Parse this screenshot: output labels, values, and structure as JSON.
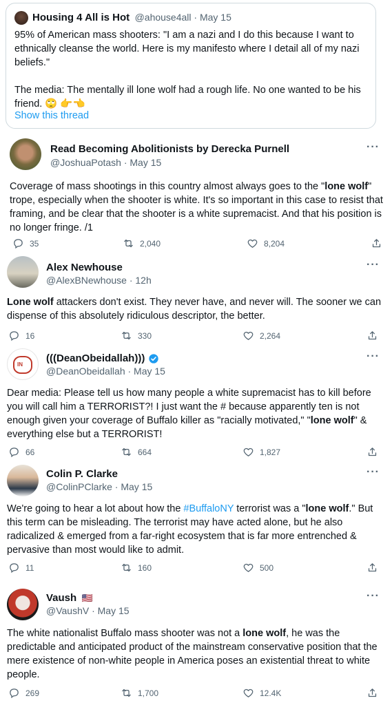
{
  "quoted": {
    "name": "Housing 4 All is Hot",
    "handle_time": "@ahouse4all · May 15",
    "line1": "95% of American mass shooters: \"I am a nazi and I do this because I want to",
    "line2": "ethnically cleanse the world. Here is my manifesto where I detail all of my nazi",
    "line3": "beliefs.\"",
    "line4": "The media: The mentally ill lone wolf had a rough life. No one wanted to be his",
    "line5": "friend.",
    "emoji": "🙄 👉👈",
    "show_thread": "Show this thread"
  },
  "tweets": [
    {
      "name": "Read Becoming Abolitionists by Derecka Purnell",
      "handle_time": "@JoshuaPotash · May 15",
      "l1a": "Coverage of mass shootings in this country almost always goes to the \"",
      "l1b": "lone wolf",
      "l1c": "\"",
      "l2": "trope, especially when the shooter is white. It's so important in this case to resist that",
      "l3": "framing, and be clear that the shooter is a white supremacist. And that his position is",
      "l4": "no longer fringe. /1",
      "replies": "35",
      "retweets": "2,040",
      "likes": "8,204"
    },
    {
      "name": "Alex Newhouse",
      "handle_time": "@AlexBNewhouse · 12h",
      "l1a": "Lone wolf",
      "l1b": " attackers don't exist. They never have, and never will. The sooner we can",
      "l2": "dispense of this absolutely ridiculous descriptor, the better.",
      "replies": "16",
      "retweets": "330",
      "likes": "2,264"
    },
    {
      "name": "(((DeanObeidallah)))",
      "handle_time": "@DeanObeidallah · May 15",
      "l1": "Dear media: Please tell us how many people a white supremacist has to kill before",
      "l2": "you will call him a TERRORIST?!  I just want the # because apparently ten is not",
      "l3a": "enough given your coverage of Buffalo killer as \"racially motivated,\" \"",
      "l3b": "lone wolf",
      "l3c": "\" &",
      "l4": "everything else but a TERRORIST!",
      "replies": "66",
      "retweets": "664",
      "likes": "1,827"
    },
    {
      "name": "Colin P. Clarke",
      "handle_time": "@ColinPClarke · May 15",
      "l1a": "We're going to hear a lot about how the ",
      "l1b": "#BuffaloNY",
      "l1c": " terrorist was a \"",
      "l1d": "lone wolf",
      "l1e": ".\" But",
      "l2": "this term can be misleading. The terrorist may have acted alone, but he also",
      "l3": "radicalized & emerged from a far-right ecosystem that is far more entrenched &",
      "l4": "pervasive than most would like to admit.",
      "replies": "11",
      "retweets": "160",
      "likes": "500"
    },
    {
      "name": "Vaush",
      "flag": "🇺🇸",
      "handle_time": "@VaushV · May 15",
      "l1a": "The white nationalist Buffalo mass shooter was not a ",
      "l1b": "lone wolf",
      "l1c": ", he was the",
      "l2": "predictable and anticipated product of the mainstream conservative position that the",
      "l3": "mere existence of non-white people in America poses an existential threat to white",
      "l4": "people.",
      "replies": "269",
      "retweets": "1,700",
      "likes": "12.4K"
    }
  ],
  "ui": {
    "more": "···"
  },
  "colors": {
    "text": "#0f1419",
    "secondary": "#536471",
    "link": "#1d9bf0",
    "border": "#cfd9de",
    "verified": "#1d9bf0"
  }
}
